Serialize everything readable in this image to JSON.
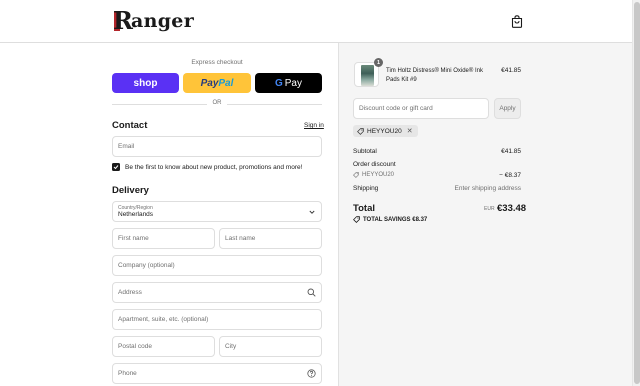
{
  "header": {
    "logo_text": "anger",
    "logo_initial": "R",
    "icons": {
      "cart": "shopping-bag-icon"
    }
  },
  "express": {
    "label": "Express checkout",
    "shop_label": "shop",
    "paypal_pay": "Pay",
    "paypal_pal": "Pal",
    "gpay_g": "G",
    "gpay_label": "Pay",
    "or_label": "OR"
  },
  "contact": {
    "title": "Contact",
    "signin_label": "Sign in",
    "email_placeholder": "Email",
    "newsletter_label": "Be the first to know about new product, promotions and more!",
    "newsletter_checked": true
  },
  "delivery": {
    "title": "Delivery",
    "country_label": "Country/Region",
    "country_value": "Netherlands",
    "first_name_placeholder": "First name",
    "last_name_placeholder": "Last name",
    "company_placeholder": "Company (optional)",
    "address_placeholder": "Address",
    "apartment_placeholder": "Apartment, suite, etc. (optional)",
    "postal_placeholder": "Postal code",
    "city_placeholder": "City",
    "phone_placeholder": "Phone"
  },
  "order": {
    "product": {
      "quantity": "1",
      "name": "Tim Holtz Distress® Mini Oxide® Ink Pads Kit #9",
      "price": "€41.85"
    },
    "discount_placeholder": "Discount code or gift card",
    "apply_label": "Apply",
    "applied_code": "HEYYOU20",
    "subtotal_label": "Subtotal",
    "subtotal_value": "€41.85",
    "order_discount_label": "Order discount",
    "order_discount_code": "HEYYOU20",
    "order_discount_value": "− €8.37",
    "shipping_label": "Shipping",
    "shipping_value": "Enter shipping address",
    "total_label": "Total",
    "total_currency": "EUR",
    "total_value": "€33.48",
    "savings_label": "TOTAL SAVINGS",
    "savings_value": "€8.37"
  },
  "colors": {
    "shop_pay": "#5a31f4",
    "paypal": "#ffc439",
    "gpay": "#000000",
    "summary_bg": "#f5f5f5",
    "brand_red": "#b3262b"
  }
}
